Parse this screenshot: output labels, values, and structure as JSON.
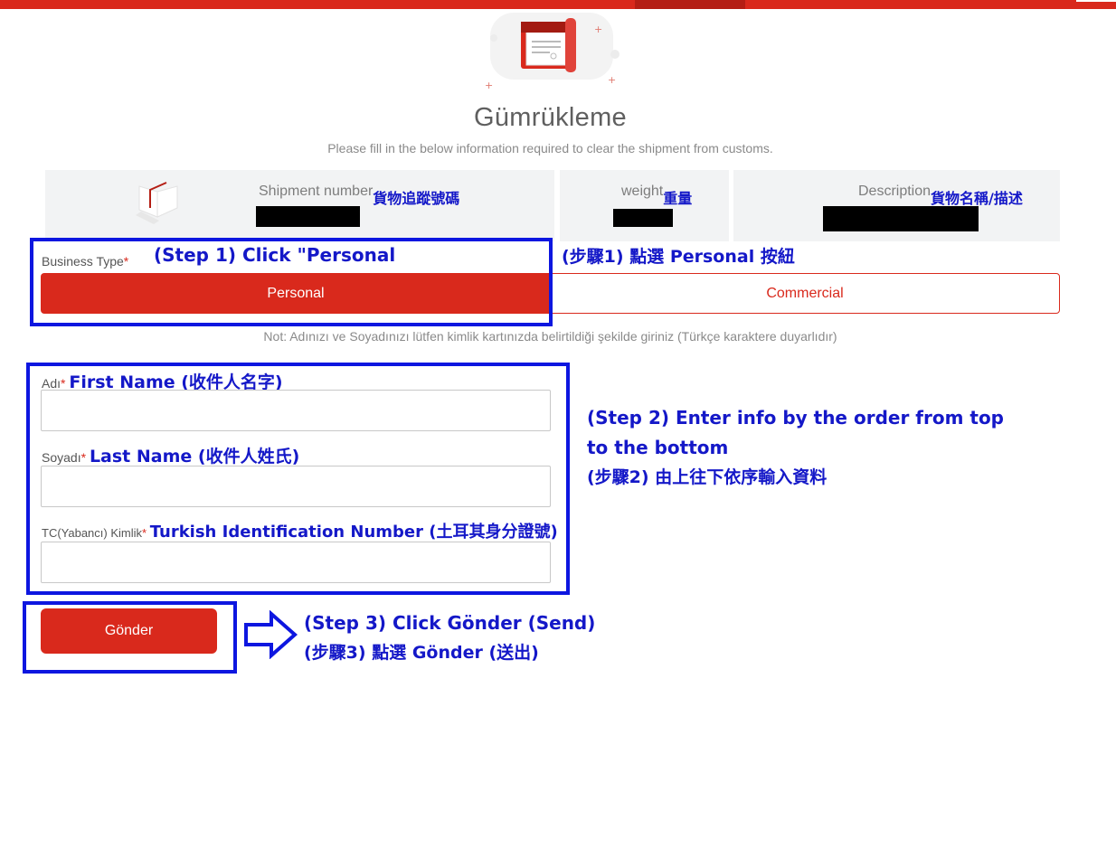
{
  "colors": {
    "brand_red": "#d9291c",
    "annotation_blue": "#1418c8"
  },
  "page": {
    "title": "Gümrükleme",
    "subtitle": "Please fill in the below information required to clear the shipment from customs."
  },
  "shipment": {
    "number_label": "Shipment number",
    "number_annotation": "貨物追蹤號碼",
    "weight_label": "weight",
    "weight_annotation": "重量",
    "description_label": "Description",
    "description_annotation": "貨物名稱/描述"
  },
  "business_type": {
    "label": "Business Type",
    "required_mark": "*",
    "options": [
      "Personal",
      "Commercial"
    ],
    "selected": "Personal"
  },
  "note": "Not: Adınızı ve Soyadınızı lütfen kimlik kartınızda belirtildiği şekilde giriniz (Türkçe karaktere duyarlıdır)",
  "form": {
    "first_name": {
      "label": "Adı",
      "required_mark": "*",
      "annotation": "First Name (收件人名字)",
      "value": ""
    },
    "last_name": {
      "label": "Soyadı",
      "required_mark": "*",
      "annotation": "Last Name (收件人姓氏)",
      "value": ""
    },
    "id_number": {
      "label": "TC(Yabancı) Kimlik",
      "required_mark": "*",
      "annotation": "Turkish Identification Number (土耳其身分證號)",
      "value": ""
    },
    "submit_label": "Gönder"
  },
  "annotations": {
    "step1_en": "(Step 1) Click \"Personal",
    "step1_zh": "(步驟1) 點選 Personal 按紐",
    "step2_line1": "(Step 2) Enter info by the order from top",
    "step2_line2": "to the bottom",
    "step2_zh": "(步驟2) 由上往下依序輸入資料",
    "step3_en": "(Step 3) Click Gönder (Send)",
    "step3_zh": "(步驟3) 點選 Gönder (送出)"
  }
}
